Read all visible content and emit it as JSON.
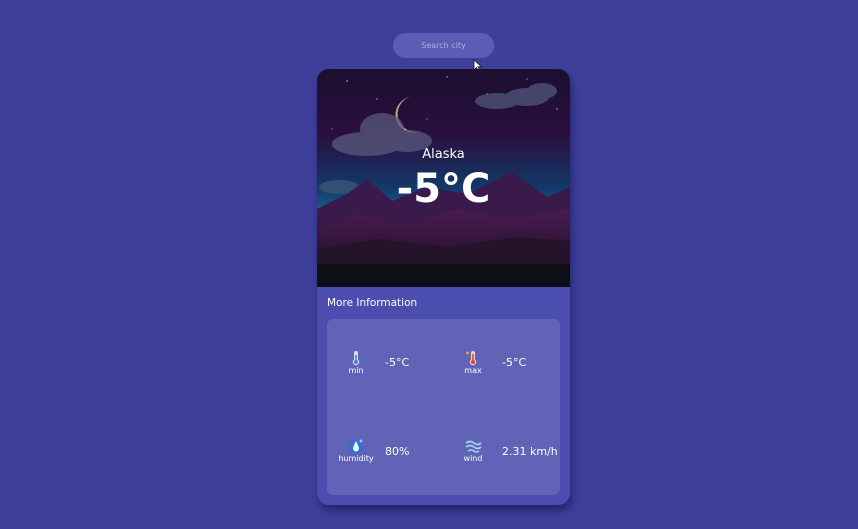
{
  "search": {
    "placeholder": "Search city"
  },
  "weather": {
    "city": "Alaska",
    "temperature": "-5°C"
  },
  "more_info": {
    "title": "More Information",
    "items": [
      {
        "label": "min",
        "value": "-5°C",
        "icon": "thermometer-icon"
      },
      {
        "label": "max",
        "value": "-5°C",
        "icon": "hot-thermometer-icon"
      },
      {
        "label": "humidity",
        "value": "80%",
        "icon": "humidity-icon"
      },
      {
        "label": "wind",
        "value": "2.31 km/h",
        "icon": "wind-icon"
      }
    ]
  },
  "colors": {
    "background": "#3d3f9b",
    "card": "#4b4daf",
    "panel": "#6163b7"
  }
}
